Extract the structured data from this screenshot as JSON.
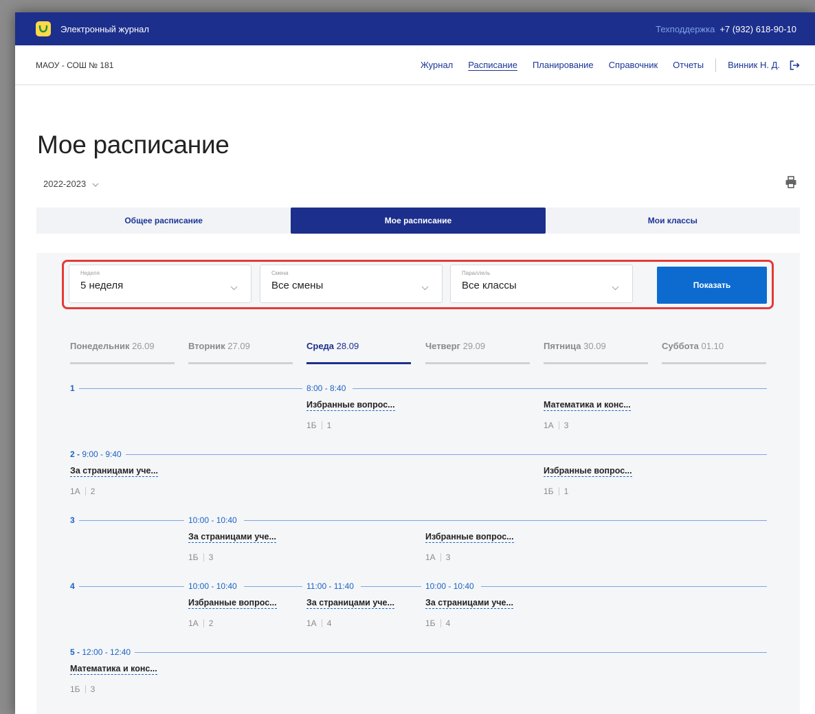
{
  "header": {
    "app_title": "Электронный журнал",
    "support_label": "Техподдержка",
    "support_phone": "+7 (932) 618-90-10"
  },
  "navbar": {
    "school": "МАОУ - СОШ № 181",
    "links": [
      "Журнал",
      "Расписание",
      "Планирование",
      "Справочник",
      "Отчеты"
    ],
    "active_link": "Расписание",
    "user": "Винник Н. Д."
  },
  "page": {
    "title": "Мое расписание",
    "year": "2022-2023"
  },
  "tabs": [
    "Общее расписание",
    "Мое расписание",
    "Мои классы"
  ],
  "filters": {
    "week": {
      "label": "Неделя",
      "value": "5 неделя"
    },
    "shift": {
      "label": "Смена",
      "value": "Все смены"
    },
    "parallel": {
      "label": "Параллель",
      "value": "Все классы"
    },
    "show_button": "Показать"
  },
  "days": [
    {
      "name": "Понедельник",
      "date": "26.09"
    },
    {
      "name": "Вторник",
      "date": "27.09"
    },
    {
      "name": "Среда",
      "date": "28.09",
      "active": true
    },
    {
      "name": "Четверг",
      "date": "29.09"
    },
    {
      "name": "Пятница",
      "date": "30.09"
    },
    {
      "name": "Суббота",
      "date": "01.10"
    }
  ],
  "lessons": [
    {
      "num": "1",
      "num_time": "",
      "entries": [
        {
          "day": 2,
          "time": "8:00 - 8:40",
          "subject": "Избранные вопрос...",
          "class": "1Б",
          "room": "1"
        },
        {
          "day": 4,
          "time": "",
          "subject": "Математика и конс...",
          "class": "1А",
          "room": "3"
        }
      ]
    },
    {
      "num": "2",
      "num_time": "9:00 - 9:40",
      "entries": [
        {
          "day": 0,
          "time": "",
          "subject": "За страницами уче...",
          "class": "1А",
          "room": "2"
        },
        {
          "day": 4,
          "time": "",
          "subject": "Избранные вопрос...",
          "class": "1Б",
          "room": "1"
        }
      ]
    },
    {
      "num": "3",
      "num_time": "",
      "entries": [
        {
          "day": 1,
          "time": "10:00 - 10:40",
          "subject": "За страницами уче...",
          "class": "1Б",
          "room": "3"
        },
        {
          "day": 3,
          "time": "",
          "subject": "Избранные вопрос...",
          "class": "1А",
          "room": "3"
        }
      ]
    },
    {
      "num": "4",
      "num_time": "",
      "entries": [
        {
          "day": 1,
          "time": "10:00 - 10:40",
          "subject": "Избранные вопрос...",
          "class": "1А",
          "room": "2"
        },
        {
          "day": 2,
          "time": "11:00 - 11:40",
          "subject": "За страницами уче...",
          "class": "1А",
          "room": "4"
        },
        {
          "day": 3,
          "time": "10:00 - 10:40",
          "subject": "За страницами уче...",
          "class": "1Б",
          "room": "4"
        }
      ]
    },
    {
      "num": "5",
      "num_time": "12:00 - 12:40",
      "entries": [
        {
          "day": 0,
          "time": "",
          "subject": "Математика и конс...",
          "class": "1Б",
          "room": "3"
        }
      ]
    }
  ],
  "colors": {
    "header_bg": "#1c2f8c",
    "accent": "#1a63c4",
    "button": "#0d6bd0",
    "highlight": "#e53935"
  }
}
